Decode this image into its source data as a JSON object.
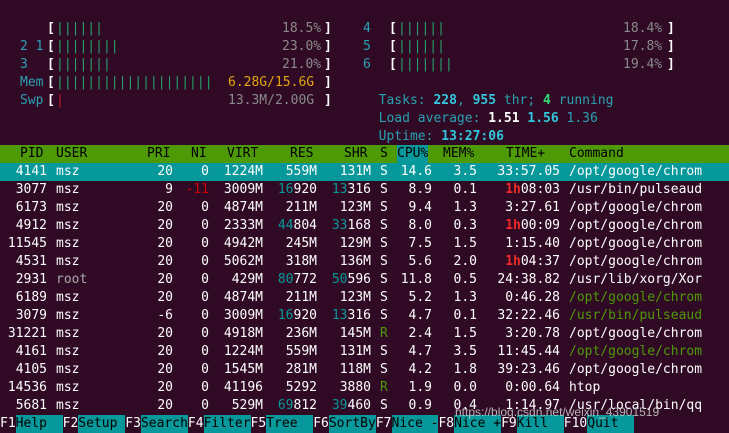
{
  "meters": {
    "cpus": [
      {
        "id": "1",
        "bar": "||||||",
        "pct": "18.5%"
      },
      {
        "id": "2",
        "bar": "||||||||",
        "pct": "23.0%"
      },
      {
        "id": "3",
        "bar": "|||||||",
        "pct": "21.0%"
      },
      {
        "id": "4",
        "bar": "||||||",
        "pct": "18.4%"
      },
      {
        "id": "5",
        "bar": "||||||",
        "pct": "17.8%"
      },
      {
        "id": "6",
        "bar": "|||||||",
        "pct": "19.4%"
      }
    ],
    "mem": {
      "label": "Mem",
      "bar": "||||||||||||||||||||",
      "value": "6.28G/15.6G"
    },
    "swp": {
      "label": "Swp",
      "bar": "|",
      "value": "13.3M/2.00G"
    },
    "tasks": {
      "label": "Tasks:",
      "count": "228",
      "thr": "955",
      "thr_label": "thr;",
      "running": "4",
      "running_label": "running"
    },
    "load": {
      "label": "Load average:",
      "l1": "1.51",
      "l5": "1.56",
      "l15": "1.36"
    },
    "uptime": {
      "label": "Uptime:",
      "value": "13:27:06"
    }
  },
  "columns": [
    "PID",
    "USER",
    "PRI",
    "NI",
    "VIRT",
    "RES",
    "SHR",
    "S",
    "CPU%",
    "MEM%",
    "TIME+",
    "Command"
  ],
  "processes": [
    {
      "pid": "4141",
      "user": "msz",
      "pri": "20",
      "ni": "0",
      "virt": "1224M",
      "res": "559M",
      "shr": "131M",
      "s": "S",
      "cpu": "14.6",
      "mem": "3.5",
      "time": "33:57.05",
      "cmd": "/opt/google/chrom",
      "selected": true
    },
    {
      "pid": "3077",
      "user": "msz",
      "pri": "9",
      "ni": "-11",
      "virt": "3009M",
      "res": "16920",
      "shr": "13316",
      "s": "S",
      "cpu": "8.9",
      "mem": "0.1",
      "time": "1h08:03",
      "cmd": "/usr/bin/pulseaud"
    },
    {
      "pid": "6173",
      "user": "msz",
      "pri": "20",
      "ni": "0",
      "virt": "4874M",
      "res": "211M",
      "shr": "123M",
      "s": "S",
      "cpu": "9.4",
      "mem": "1.3",
      "time": "3:27.61",
      "cmd": "/opt/google/chrom"
    },
    {
      "pid": "4912",
      "user": "msz",
      "pri": "20",
      "ni": "0",
      "virt": "2333M",
      "res": "44804",
      "shr": "33168",
      "s": "S",
      "cpu": "8.0",
      "mem": "0.3",
      "time": "1h00:09",
      "cmd": "/opt/google/chrom"
    },
    {
      "pid": "11545",
      "user": "msz",
      "pri": "20",
      "ni": "0",
      "virt": "4942M",
      "res": "245M",
      "shr": "129M",
      "s": "S",
      "cpu": "7.5",
      "mem": "1.5",
      "time": "1:15.40",
      "cmd": "/opt/google/chrom"
    },
    {
      "pid": "4531",
      "user": "msz",
      "pri": "20",
      "ni": "0",
      "virt": "5062M",
      "res": "318M",
      "shr": "136M",
      "s": "S",
      "cpu": "5.6",
      "mem": "2.0",
      "time": "1h04:37",
      "cmd": "/opt/google/chrom"
    },
    {
      "pid": "2931",
      "user": "root",
      "pri": "20",
      "ni": "0",
      "virt": "429M",
      "res": "80772",
      "shr": "50596",
      "s": "S",
      "cpu": "11.8",
      "mem": "0.5",
      "time": "24:38.82",
      "cmd": "/usr/lib/xorg/Xor"
    },
    {
      "pid": "6189",
      "user": "msz",
      "pri": "20",
      "ni": "0",
      "virt": "4874M",
      "res": "211M",
      "shr": "123M",
      "s": "S",
      "cpu": "5.2",
      "mem": "1.3",
      "time": "0:46.28",
      "cmd": "/opt/google/chrom"
    },
    {
      "pid": "3079",
      "user": "msz",
      "pri": "-6",
      "ni": "0",
      "virt": "3009M",
      "res": "16920",
      "shr": "13316",
      "s": "S",
      "cpu": "4.7",
      "mem": "0.1",
      "time": "32:22.46",
      "cmd": "/usr/bin/pulseaud"
    },
    {
      "pid": "31221",
      "user": "msz",
      "pri": "20",
      "ni": "0",
      "virt": "4918M",
      "res": "236M",
      "shr": "145M",
      "s": "R",
      "cpu": "2.4",
      "mem": "1.5",
      "time": "3:20.78",
      "cmd": "/opt/google/chrom"
    },
    {
      "pid": "4161",
      "user": "msz",
      "pri": "20",
      "ni": "0",
      "virt": "1224M",
      "res": "559M",
      "shr": "131M",
      "s": "S",
      "cpu": "4.7",
      "mem": "3.5",
      "time": "11:45.44",
      "cmd": "/opt/google/chrom"
    },
    {
      "pid": "4105",
      "user": "msz",
      "pri": "20",
      "ni": "0",
      "virt": "1545M",
      "res": "281M",
      "shr": "118M",
      "s": "S",
      "cpu": "4.2",
      "mem": "1.8",
      "time": "39:23.46",
      "cmd": "/opt/google/chrom"
    },
    {
      "pid": "14536",
      "user": "msz",
      "pri": "20",
      "ni": "0",
      "virt": "41196",
      "res": "5292",
      "shr": "3880",
      "s": "R",
      "cpu": "1.9",
      "mem": "0.0",
      "time": "0:00.64",
      "cmd": "htop"
    },
    {
      "pid": "5681",
      "user": "msz",
      "pri": "20",
      "ni": "0",
      "virt": "529M",
      "res": "69812",
      "shr": "39460",
      "s": "S",
      "cpu": "0.9",
      "mem": "0.4",
      "time": "1:14.97",
      "cmd": "/usr/local/bin/qq"
    }
  ],
  "fkeys": [
    {
      "key": "F1",
      "label": "Help"
    },
    {
      "key": "F2",
      "label": "Setup"
    },
    {
      "key": "F3",
      "label": "Search"
    },
    {
      "key": "F4",
      "label": "Filter"
    },
    {
      "key": "F5",
      "label": "Tree"
    },
    {
      "key": "F6",
      "label": "SortBy"
    },
    {
      "key": "F7",
      "label": "Nice -"
    },
    {
      "key": "F8",
      "label": "Nice +"
    },
    {
      "key": "F9",
      "label": "Kill"
    },
    {
      "key": "F10",
      "label": "Quit"
    }
  ],
  "watermark": "https://blog.csdn.net/weixin_43901519"
}
